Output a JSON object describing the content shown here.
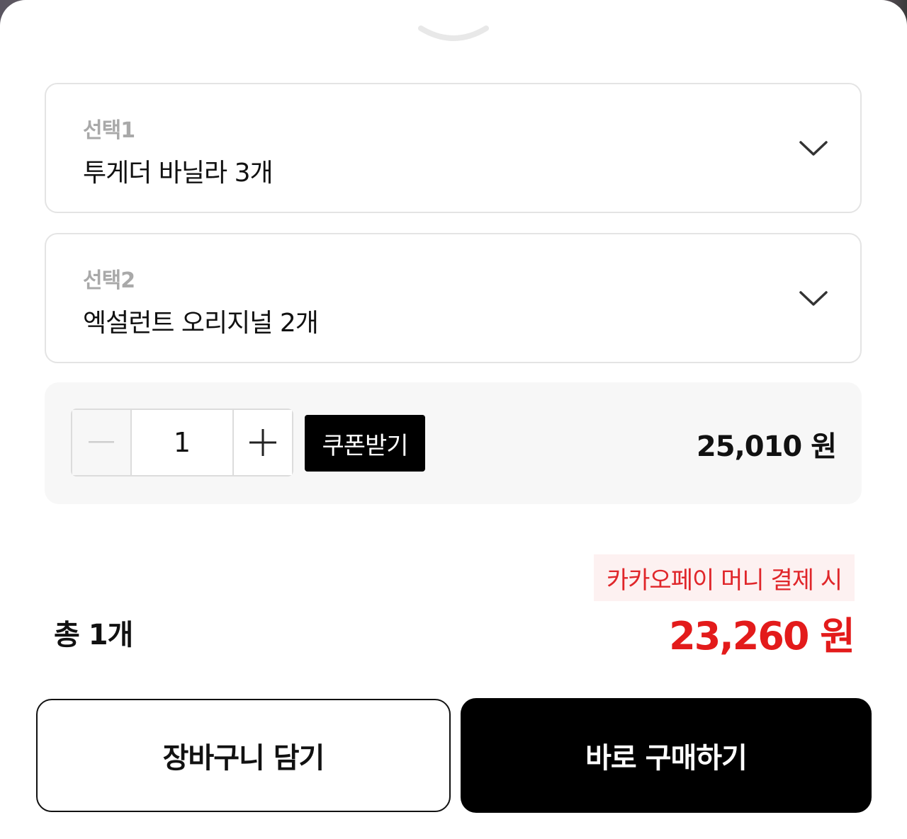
{
  "sheet": {
    "handle_icon": "chevron-down-icon"
  },
  "options": [
    {
      "label": "선택1",
      "value": "투게더 바닐라 3개",
      "icon": "chevron-down-icon"
    },
    {
      "label": "선택2",
      "value": "엑설런트 오리지널 2개",
      "icon": "chevron-down-icon"
    }
  ],
  "quantity": {
    "value": "1",
    "minus_icon": "minus-icon",
    "plus_icon": "plus-icon",
    "coupon_label": "쿠폰받기",
    "line_price": "25,010 원"
  },
  "summary": {
    "promo_label": "카카오페이 머니 결제 시",
    "total_count": "총 1개",
    "total_price": "23,260 원",
    "accent_color": "#e31b1b"
  },
  "actions": {
    "cart_label": "장바구니 담기",
    "buy_label": "바로 구매하기"
  }
}
